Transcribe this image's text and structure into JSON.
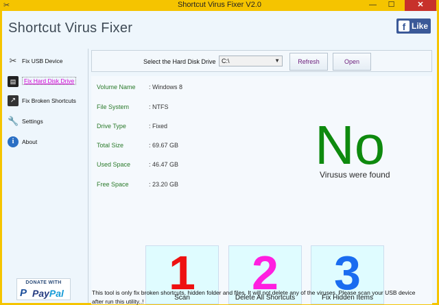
{
  "window": {
    "title": "Shortcut Virus Fixer V2.0",
    "min": "—",
    "max": "☐",
    "close": "✕"
  },
  "app": {
    "title": "Shortcut Virus Fixer",
    "like_label": "Like",
    "fb_letter": "f"
  },
  "sidebar": {
    "items": [
      {
        "label": "Fix USB Device",
        "icon": "usb-icon"
      },
      {
        "label": "Fix Hard Disk Drive",
        "icon": "hard-drive-icon"
      },
      {
        "label": "Fix Broken Shortcuts",
        "icon": "shortcut-icon"
      },
      {
        "label": "Settings",
        "icon": "wrench-icon"
      },
      {
        "label": "About",
        "icon": "info-icon"
      }
    ],
    "active_index": 1
  },
  "donate": {
    "top": "DONATE WITH",
    "brand_a": "Pay",
    "brand_b": "Pal",
    "p": "P"
  },
  "toolbar": {
    "select_label": "Select the Hard Disk Drive",
    "drive_value": "C:\\",
    "refresh_label": "Refresh",
    "open_label": "Open"
  },
  "info": [
    {
      "label": "Volume Name",
      "value": ": Windows 8"
    },
    {
      "label": "File System",
      "value": ": NTFS"
    },
    {
      "label": "Drive Type",
      "value": ": Fixed"
    },
    {
      "label": "Total Size",
      "value": ": 69.67 GB"
    },
    {
      "label": "Used Space",
      "value": ": 46.47 GB"
    },
    {
      "label": "Free Space",
      "value": ": 23.20 GB"
    }
  ],
  "result": {
    "big": "No",
    "sub": "Virusus were found"
  },
  "actions": [
    {
      "num": "1",
      "label": "Scan"
    },
    {
      "num": "2",
      "label": "Delete All Shortcuts"
    },
    {
      "num": "3",
      "label": "Fix Hidden Items"
    }
  ],
  "footer_note": "This tool is only fix broken shortcuts, hidden folder and files. It will not delete any of the viruses. Please scan your USB device after run this utility..!",
  "colors": {
    "titlebar": "#f5c400",
    "client_bg": "#eef6fc",
    "label_green": "#2a7a2a",
    "result_green": "#0e8a0e",
    "tile_bg": "#dffcff"
  }
}
